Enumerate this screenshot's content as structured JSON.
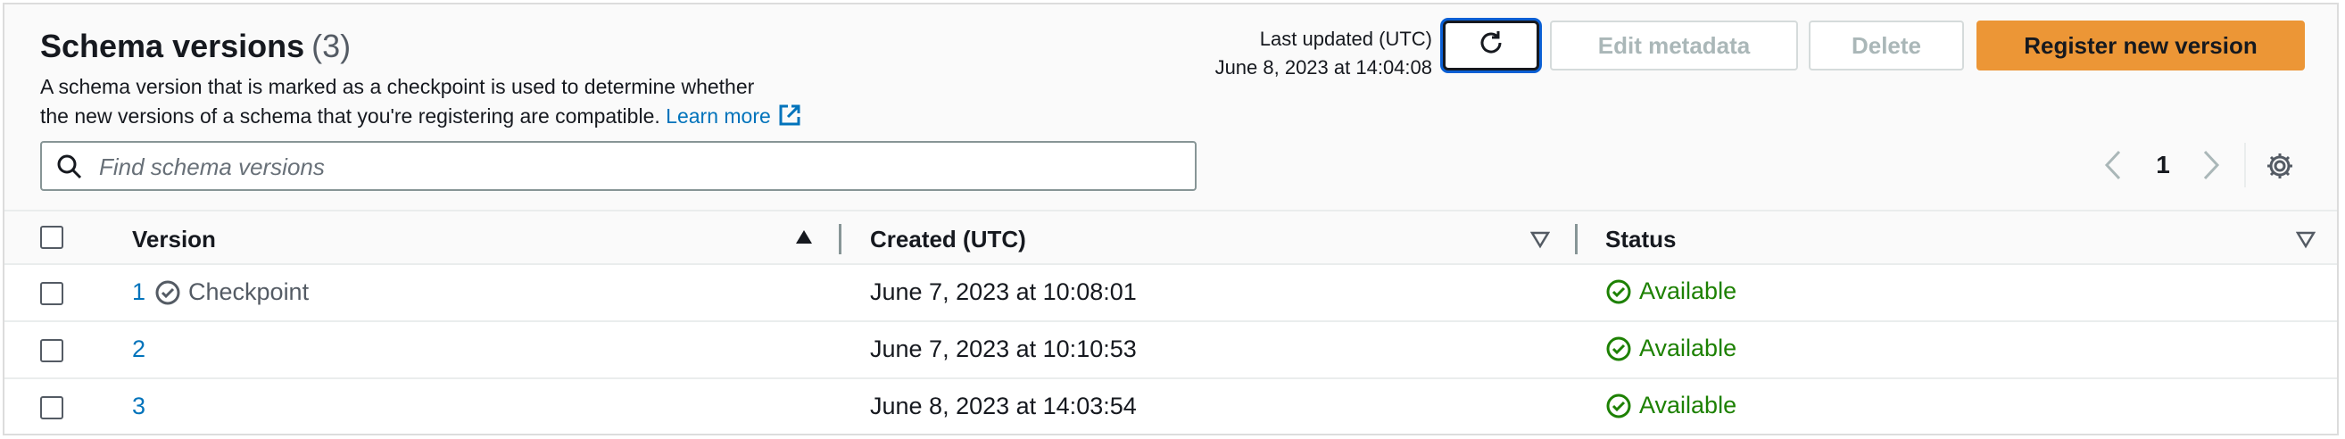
{
  "header": {
    "title": "Schema versions",
    "count": "(3)",
    "description_line1": "A schema version that is marked as a checkpoint is used to determine whether",
    "description_line2": "the new versions of a schema that you're registering are compatible.",
    "learn_more": "Learn more",
    "last_updated_label": "Last updated (UTC)",
    "last_updated_value": "June 8, 2023 at 14:04:08"
  },
  "actions": {
    "edit_metadata": "Edit metadata",
    "delete": "Delete",
    "register_new_version": "Register new version"
  },
  "search": {
    "placeholder": "Find schema versions"
  },
  "pagination": {
    "current_page": "1"
  },
  "table": {
    "columns": [
      "Version",
      "Created (UTC)",
      "Status"
    ],
    "rows": [
      {
        "version": "1",
        "checkpoint": "Checkpoint",
        "created": "June 7, 2023 at 10:08:01",
        "status": "Available"
      },
      {
        "version": "2",
        "checkpoint": "",
        "created": "June 7, 2023 at 10:10:53",
        "status": "Available"
      },
      {
        "version": "3",
        "checkpoint": "",
        "created": "June 8, 2023 at 14:03:54",
        "status": "Available"
      }
    ]
  },
  "icons": {
    "refresh": "refresh-icon",
    "external": "external-link-icon",
    "search": "search-icon",
    "prev": "chevron-left-icon",
    "next": "chevron-right-icon",
    "settings": "gear-icon",
    "sort_asc": "sort-ascending-icon",
    "sort_default": "sort-caret-icon",
    "checkpoint": "check-circle-icon",
    "status_ok": "status-success-icon"
  },
  "colors": {
    "primary_button": "#ec9636",
    "link": "#0073bb",
    "success": "#1d8102",
    "focus_ring": "#0a5fd4"
  }
}
